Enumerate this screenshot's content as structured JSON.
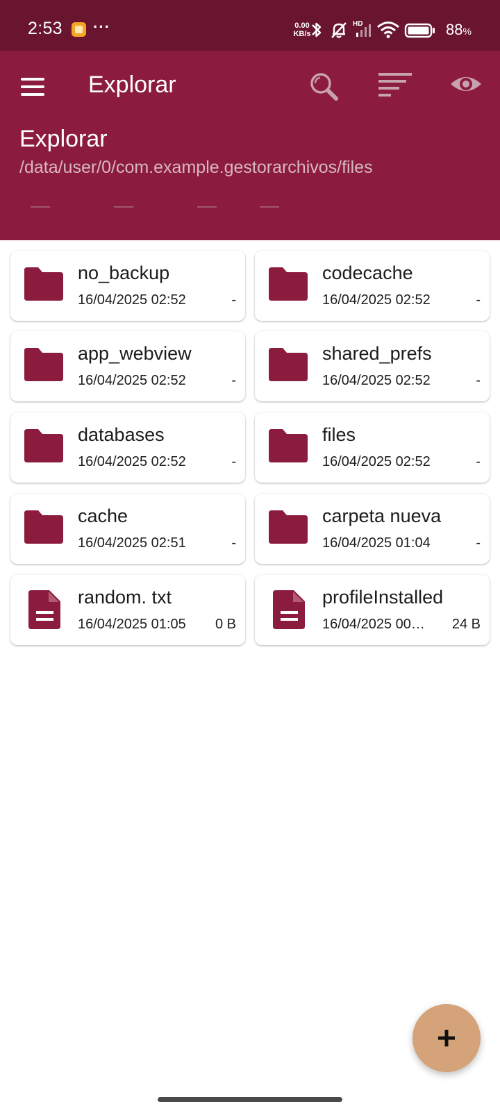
{
  "status_bar": {
    "time": "2:53",
    "more": "···",
    "net_speed_value": "0.00",
    "net_speed_unit": "KB/s",
    "network_label": "HD",
    "battery_value": "88",
    "battery_unit": "%"
  },
  "app_bar": {
    "title": "Explorar",
    "menu_icon": "hamburger-menu-icon",
    "search_icon": "search-icon",
    "sort_icon": "sort-icon",
    "visibility_icon": "eye-icon"
  },
  "header": {
    "heading": "Explorar",
    "path": "/data/user/0/com.example.gestorarchivos/files"
  },
  "items": [
    {
      "name": "no_backup",
      "date": "16/04/2025 02:52",
      "size": "-",
      "type": "folder"
    },
    {
      "name": "codecache",
      "date": "16/04/2025 02:52",
      "size": "-",
      "type": "folder"
    },
    {
      "name": "app_webview",
      "date": "16/04/2025 02:52",
      "size": "-",
      "type": "folder"
    },
    {
      "name": "shared_prefs",
      "date": "16/04/2025 02:52",
      "size": "-",
      "type": "folder"
    },
    {
      "name": "databases",
      "date": "16/04/2025 02:52",
      "size": "-",
      "type": "folder"
    },
    {
      "name": "files",
      "date": "16/04/2025 02:52",
      "size": "-",
      "type": "folder"
    },
    {
      "name": "cache",
      "date": "16/04/2025 02:51",
      "size": "-",
      "type": "folder"
    },
    {
      "name": "carpeta nueva",
      "date": "16/04/2025 01:04",
      "size": "-",
      "type": "folder"
    },
    {
      "name": "random. txt",
      "date": "16/04/2025 01:05",
      "size": "0 B",
      "type": "file"
    },
    {
      "name": "profileInstalled",
      "date": "16/04/2025 00…",
      "size": "24 B",
      "type": "file"
    }
  ],
  "fab": {
    "label": "+",
    "icon": "add-icon"
  },
  "colors": {
    "status_bar": "#691530",
    "app_bar": "#8b1c3e",
    "accent": "#8b1c3e",
    "fab": "#d4a37a"
  }
}
